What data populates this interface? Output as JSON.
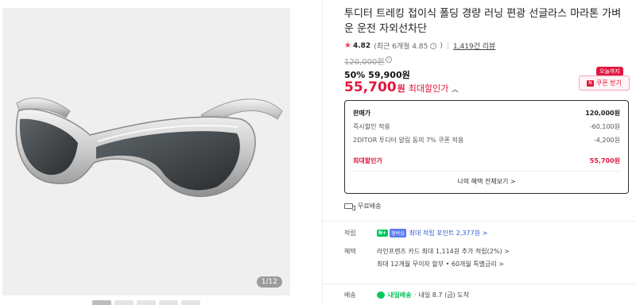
{
  "gallery": {
    "counter": "1/12",
    "thumb_count": 5
  },
  "product": {
    "title": "투디터 트레킹 접이식 폴딩 경량 러닝 편광 선글라스 마라톤 가벼운 운전 자외선차단",
    "rating": {
      "star_icon": "star-icon",
      "score": "4.82",
      "recent": "(최근 6개월 4.85",
      "recent_close": ")",
      "reviews": "1,419건 리뷰"
    },
    "original_price": "120,000원",
    "discount_line": "50% 59,900원",
    "final_price": "55,700",
    "final_price_unit": "원",
    "final_price_label": "최대할인가",
    "today_badge": "오늘까지",
    "coupon_button": "쿠폰 받기"
  },
  "breakdown": {
    "rows": [
      {
        "label": "판매가",
        "value": "120,000원"
      },
      {
        "label": "즉시할인 적용",
        "value": "-60,100원"
      },
      {
        "label": "2DITOR 투디터 알림 동의 7% 쿠폰 적용",
        "value": "-4,200원"
      },
      {
        "label": "최대할인가",
        "value": "55,700원"
      }
    ],
    "benefits_button": "나의 혜택 전체보기 >"
  },
  "shipping": {
    "free_label": "무료배송"
  },
  "details": {
    "points": {
      "key": "적립",
      "npay": "N+",
      "membership": "멤버십",
      "text": "최대 적립 포인트 2,377원 >"
    },
    "benefits": {
      "key": "혜택",
      "line1": "라인프렌즈 카드 최대 1,114원 추가 적립(2%) >",
      "line2": "최대 12개월 무이자 할부 • 60개월 특별금리 >"
    },
    "delivery": {
      "key": "배송",
      "service": "내일배송",
      "text": "· 내일 8.7 (금) 도착"
    }
  },
  "colors": {
    "accent": "#e0173f",
    "naver_green": "#03c75a",
    "link_blue": "#2c5bdc"
  }
}
